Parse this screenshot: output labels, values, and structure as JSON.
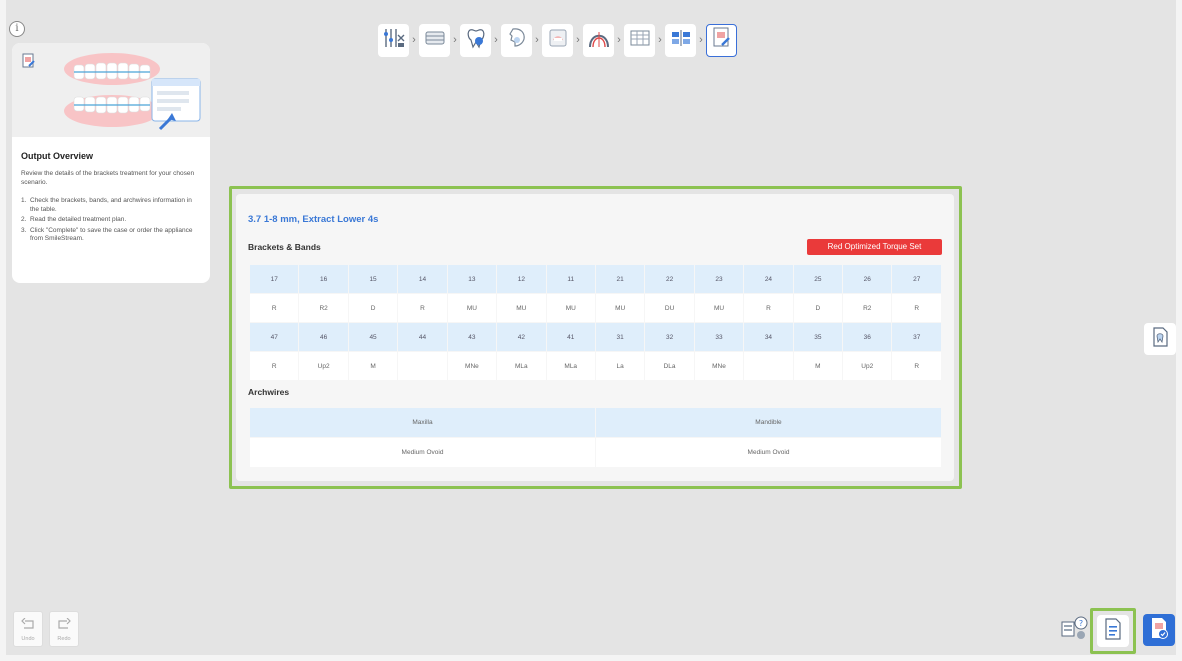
{
  "info_icon": "i",
  "help": {
    "title": "Output Overview",
    "description": "Review the details of the brackets treatment for your chosen scenario.",
    "steps": [
      {
        "num": "1.",
        "text": "Check the brackets, bands, and archwires information in the table."
      },
      {
        "num": "2.",
        "text": "Read the detailed treatment plan."
      },
      {
        "num": "3.",
        "text": "Click \"Complete\" to save the case or order the appliance from SmileStream."
      }
    ]
  },
  "workflow": {
    "steps": [
      {
        "icon": "tools-icon",
        "active": false
      },
      {
        "icon": "bracket-icon",
        "active": false
      },
      {
        "icon": "tooth-icon",
        "active": false
      },
      {
        "icon": "face-profile-icon",
        "active": false
      },
      {
        "icon": "jaw-icon",
        "active": false
      },
      {
        "icon": "arch-icon",
        "active": false
      },
      {
        "icon": "chart-grid-icon",
        "active": false
      },
      {
        "icon": "alignment-icon",
        "active": false
      },
      {
        "icon": "output-document-icon",
        "active": true
      }
    ]
  },
  "output": {
    "scenario_title": "3.7 1-8 mm, Extract Lower 4s",
    "brackets_label": "Brackets & Bands",
    "torque_badge": "Red Optimized Torque Set",
    "upper_numbers": [
      "17",
      "16",
      "15",
      "14",
      "13",
      "12",
      "11",
      "21",
      "22",
      "23",
      "24",
      "25",
      "26",
      "27"
    ],
    "upper_values": [
      "R",
      "R2",
      "D",
      "R",
      "MU",
      "MU",
      "MU",
      "MU",
      "DU",
      "MU",
      "R",
      "D",
      "R2",
      "R"
    ],
    "lower_numbers": [
      "47",
      "46",
      "45",
      "44",
      "43",
      "42",
      "41",
      "31",
      "32",
      "33",
      "34",
      "35",
      "36",
      "37"
    ],
    "lower_values": [
      "R",
      "Up2",
      "M",
      "",
      "MNe",
      "MLa",
      "MLa",
      "La",
      "DLa",
      "MNe",
      "",
      "M",
      "Up2",
      "R"
    ],
    "archwires_label": "Archwires",
    "arch_headers": [
      "Maxilla",
      "Mandible"
    ],
    "arch_values": [
      "Medium Ovoid",
      "Medium Ovoid"
    ]
  },
  "history": {
    "undo": "Undo",
    "redo": "Redo"
  },
  "colors": {
    "accent": "#3a78d6",
    "highlight": "#8cc251",
    "badge": "#ea3a3a",
    "table_header": "#dfeefb"
  }
}
